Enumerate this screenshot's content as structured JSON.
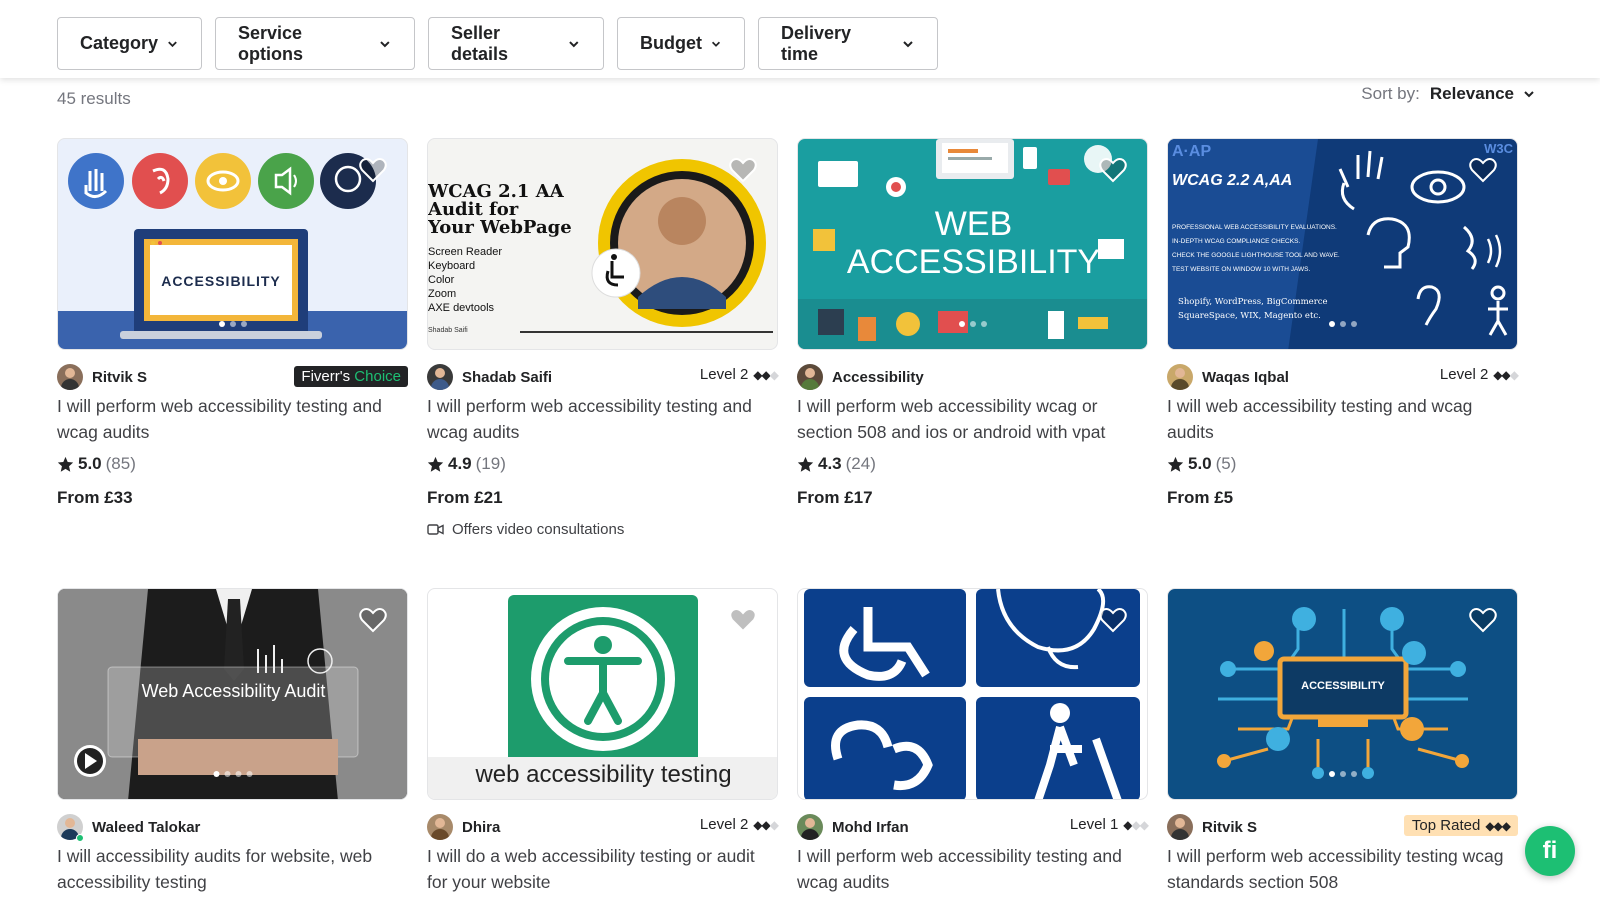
{
  "filters": [
    {
      "label": "Category"
    },
    {
      "label": "Service options"
    },
    {
      "label": "Seller details"
    },
    {
      "label": "Budget"
    },
    {
      "label": "Delivery time"
    }
  ],
  "results": {
    "count_text": "45 results"
  },
  "sort": {
    "label": "Sort by:",
    "value": "Relevance"
  },
  "gigs": [
    {
      "thumb_text": "ACCESSIBILITY",
      "seller": "Ritvik S",
      "badge_left": "Fiverr's",
      "badge_right": "Choice",
      "title": "I will perform web accessibility testing and wcag audits",
      "rating": "5.0",
      "reviews": "(85)",
      "price": "From £33"
    },
    {
      "thumb_lines": [
        "WCAG 2.1 AA",
        "Audit for",
        "Your WebPage"
      ],
      "thumb_sub": [
        "Screen Reader",
        "Keyboard",
        "Color",
        "Zoom",
        "AXE devtools"
      ],
      "thumb_sign": "Shadab Saifi",
      "seller": "Shadab Saifi",
      "level": "Level 2",
      "title": "I will perform web accessibility testing and wcag audits",
      "rating": "4.9",
      "reviews": "(19)",
      "price": "From £21",
      "extra": "Offers video consultations"
    },
    {
      "thumb_lines": [
        "WEB",
        "ACCESSIBILITY"
      ],
      "seller": "Accessibility",
      "title": "I will perform web accessibility wcag or section 508 and ios or android with vpat",
      "rating": "4.3",
      "reviews": "(24)",
      "price": "From £17"
    },
    {
      "thumb_head": "WCAG 2.2 A,AA",
      "thumb_logo": "A·AP",
      "thumb_corner": "W3C",
      "thumb_lines": [
        "PROFESSIONAL WEB ACCESSIBILITY EVALUATIONS.",
        "IN-DEPTH WCAG COMPLIANCE CHECKS.",
        "CHECK THE GOOGLE LIGHTHOUSE TOOL AND WAVE.",
        "TEST WEBSITE ON WINDOW 10 WITH JAWS."
      ],
      "thumb_platforms": [
        "Shopify, WordPress, BigCommerce",
        "SquareSpace, WIX, Magento etc."
      ],
      "seller": "Waqas Iqbal",
      "level": "Level 2",
      "title": "I will web accessibility testing and wcag audits",
      "rating": "5.0",
      "reviews": "(5)",
      "price": "From £5"
    },
    {
      "thumb_text": "Web Accessibility Audit",
      "seller": "Waleed Talokar",
      "title": "I will accessibility audits for website, web accessibility testing"
    },
    {
      "thumb_text": "web accessibility testing",
      "seller": "Dhira",
      "level": "Level 2",
      "title": "I will do a web accessibility testing or audit for your website"
    },
    {
      "seller": "Mohd Irfan",
      "level": "Level 1",
      "title": "I will perform web accessibility testing and wcag audits"
    },
    {
      "thumb_text": "ACCESSIBILITY",
      "seller": "Ritvik S",
      "badge": "Top Rated",
      "title": "I will perform web accessibility testing wcag standards section 508"
    }
  ],
  "fab": {
    "label": "fi"
  },
  "colors": {
    "brand_green": "#1dbf73",
    "text_dark": "#222325",
    "text_muted": "#74767e",
    "top_rated_bg": "#ffe0b3"
  }
}
